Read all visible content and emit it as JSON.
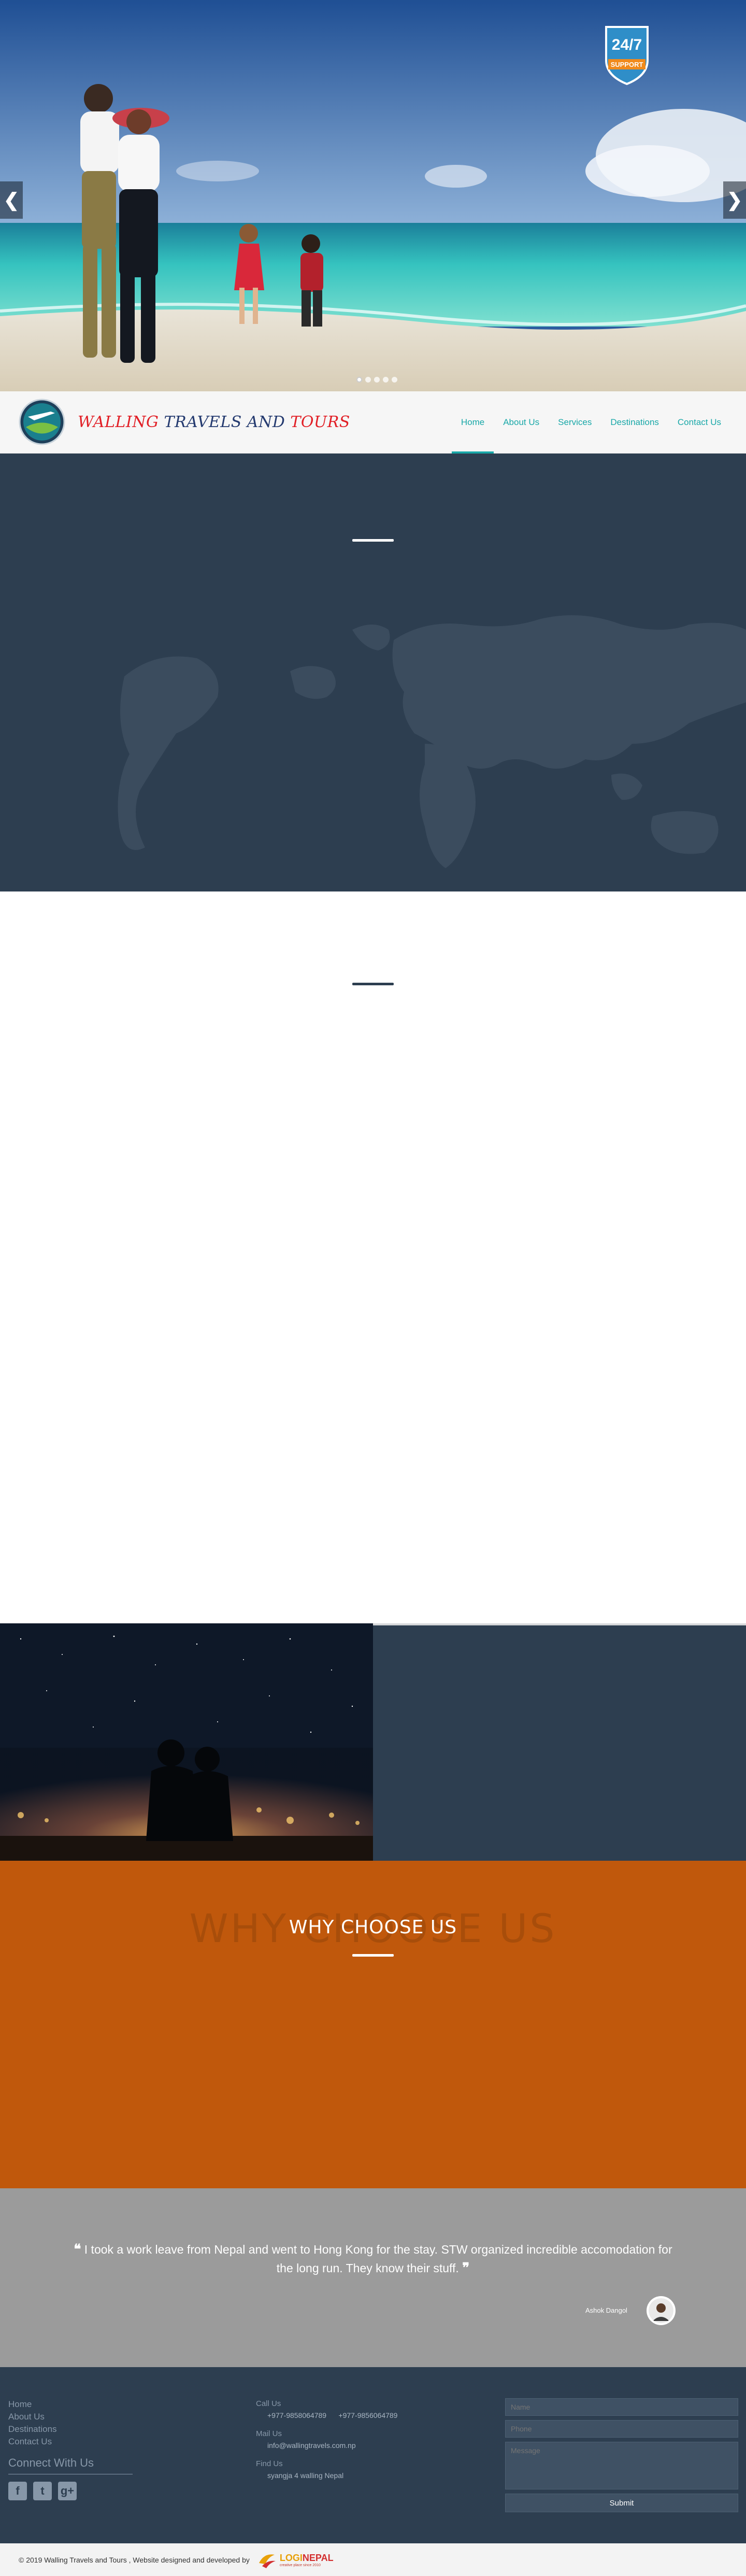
{
  "hero": {
    "badge_top": "24/7",
    "badge_bottom": "SUPPORT",
    "prev_arrow": "❮",
    "next_arrow": "❯",
    "dots": [
      true,
      false,
      false,
      false,
      false
    ]
  },
  "brand": {
    "part1": "WALLING ",
    "part2": "TRAVELS AND ",
    "part3": "TOURS"
  },
  "nav": {
    "items": [
      {
        "label": "Home",
        "active": true
      },
      {
        "label": "About Us",
        "active": false
      },
      {
        "label": "Services",
        "active": false
      },
      {
        "label": "Destinations",
        "active": false
      },
      {
        "label": "Contact Us",
        "active": false
      }
    ]
  },
  "why": {
    "ghost": "WHY CHOOSE US",
    "title": "WHY CHOOSE US"
  },
  "testimonial": {
    "open_quote": "❝",
    "close_quote": "❞",
    "quote": "I took a work leave from Nepal and went to Hong Kong for the stay. STW organized incredible accomodation for the long run. They know their stuff.",
    "author": "Ashok Dangol"
  },
  "footer": {
    "links": [
      "Home",
      "About Us",
      "Destinations",
      "Contact Us"
    ],
    "connect_title": "Connect With Us",
    "social_icons": [
      "facebook-icon",
      "twitter-icon",
      "google-plus-icon"
    ],
    "call_label": "Call Us",
    "phone1": "+977-9858064789",
    "phone2": "+977-9856064789",
    "mail_label": "Mail Us",
    "email": "info@wallingtravels.com.np",
    "find_label": "Find Us",
    "address": "syangja 4 walling Nepal",
    "form": {
      "name_placeholder": "Name",
      "phone_placeholder": "Phone",
      "message_placeholder": "Message",
      "submit_label": "Submit"
    }
  },
  "copyright": {
    "text": "© 2019 Walling Travels and Tours , Website designed and developed by",
    "dev_name_1": "LOGI",
    "dev_name_2": "NEPAL",
    "dev_tagline": "creative place since 2010"
  },
  "colors": {
    "accent": "#19a8a8",
    "dark": "#2d3e50",
    "orange": "#c0580c",
    "testimonial_bg": "#9b9b9b"
  }
}
